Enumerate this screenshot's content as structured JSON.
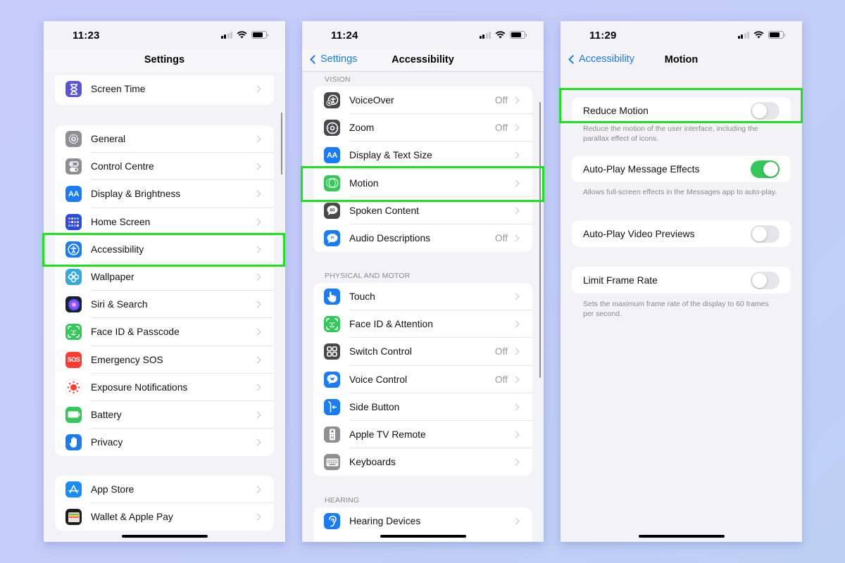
{
  "status_bar_common": {
    "signal": "signal-icon",
    "wifi": "wifi-icon",
    "battery": "battery-icon"
  },
  "settings": {
    "time": "11:23",
    "title": "Settings",
    "groups": [
      [
        {
          "label": "Screen Time",
          "icon": "hourglass-icon",
          "color": "#5856d6"
        }
      ],
      [
        {
          "label": "General",
          "icon": "gear-icon",
          "color": "#8e8e93"
        },
        {
          "label": "Control Centre",
          "icon": "switches-icon",
          "color": "#8e8e93"
        },
        {
          "label": "Display & Brightness",
          "icon": "text-size-icon",
          "color": "#1a7cf5",
          "glyph": "AA"
        },
        {
          "label": "Home Screen",
          "icon": "home-grid-icon",
          "color": "#2c4be0"
        },
        {
          "label": "Accessibility",
          "icon": "accessibility-icon",
          "color": "#1a7cf5"
        },
        {
          "label": "Wallpaper",
          "icon": "flower-icon",
          "color": "#33aadc"
        },
        {
          "label": "Siri & Search",
          "icon": "siri-icon",
          "color": "#1c1c2e"
        },
        {
          "label": "Face ID & Passcode",
          "icon": "face-id-icon",
          "color": "#34c759"
        },
        {
          "label": "Emergency SOS",
          "icon": "sos-icon",
          "color": "#ff3b30",
          "glyph": "SOS"
        },
        {
          "label": "Exposure Notifications",
          "icon": "exposure-icon",
          "color": "#ffffff"
        },
        {
          "label": "Battery",
          "icon": "battery-app-icon",
          "color": "#34c759"
        },
        {
          "label": "Privacy",
          "icon": "hand-icon",
          "color": "#1a7cf5"
        }
      ],
      [
        {
          "label": "App Store",
          "icon": "app-store-icon",
          "color": "#1a8cf5"
        },
        {
          "label": "Wallet & Apple Pay",
          "icon": "wallet-icon",
          "color": "#1c1c1e"
        }
      ]
    ],
    "highlighted": "Accessibility"
  },
  "accessibility": {
    "time": "11:24",
    "title": "Accessibility",
    "back_label": "Settings",
    "sections": [
      {
        "header": "VISION",
        "items": [
          {
            "label": "VoiceOver",
            "value": "Off",
            "icon": "voiceover-icon",
            "color": "#48484a"
          },
          {
            "label": "Zoom",
            "value": "Off",
            "icon": "zoom-icon",
            "color": "#48484a"
          },
          {
            "label": "Display & Text Size",
            "value": "",
            "icon": "text-size-icon",
            "color": "#1a7cf5",
            "glyph": "AA"
          },
          {
            "label": "Motion",
            "value": "",
            "icon": "motion-icon",
            "color": "#34c759"
          },
          {
            "label": "Spoken Content",
            "value": "",
            "icon": "speech-bubble-icon",
            "color": "#48484a"
          },
          {
            "label": "Audio Descriptions",
            "value": "Off",
            "icon": "quote-bubble-icon",
            "color": "#1a7cf5"
          }
        ]
      },
      {
        "header": "PHYSICAL AND MOTOR",
        "items": [
          {
            "label": "Touch",
            "value": "",
            "icon": "hand-point-icon",
            "color": "#1a7cf5"
          },
          {
            "label": "Face ID & Attention",
            "value": "",
            "icon": "face-id-icon",
            "color": "#34c759"
          },
          {
            "label": "Switch Control",
            "value": "Off",
            "icon": "switch-grid-icon",
            "color": "#48484a"
          },
          {
            "label": "Voice Control",
            "value": "Off",
            "icon": "voice-control-icon",
            "color": "#1a7cf5"
          },
          {
            "label": "Side Button",
            "value": "",
            "icon": "side-button-icon",
            "color": "#1a7cf5"
          },
          {
            "label": "Apple TV Remote",
            "value": "",
            "icon": "remote-icon",
            "color": "#8e8e93"
          },
          {
            "label": "Keyboards",
            "value": "",
            "icon": "keyboard-icon",
            "color": "#8e8e93"
          }
        ]
      },
      {
        "header": "HEARING",
        "items": [
          {
            "label": "Hearing Devices",
            "value": "",
            "icon": "ear-icon",
            "color": "#1a7cf5"
          }
        ]
      }
    ],
    "highlighted": "Motion"
  },
  "motion": {
    "time": "11:29",
    "title": "Motion",
    "back_label": "Accessibility",
    "settings": [
      {
        "label": "Reduce Motion",
        "on": false,
        "footnote": "Reduce the motion of the user interface, including the parallax effect of icons."
      },
      {
        "label": "Auto-Play Message Effects",
        "on": true,
        "footnote": "Allows full-screen effects in the Messages app to auto-play."
      },
      {
        "label": "Auto-Play Video Previews",
        "on": false,
        "footnote": ""
      },
      {
        "label": "Limit Frame Rate",
        "on": false,
        "footnote": "Sets the maximum frame rate of the display to 60 frames per second."
      }
    ],
    "highlighted": "Reduce Motion"
  },
  "colors": {
    "highlight": "#1de21d",
    "ios_blue": "#1a7cf5",
    "toggle_on": "#34c759",
    "toggle_off": "#e5e5ea"
  }
}
